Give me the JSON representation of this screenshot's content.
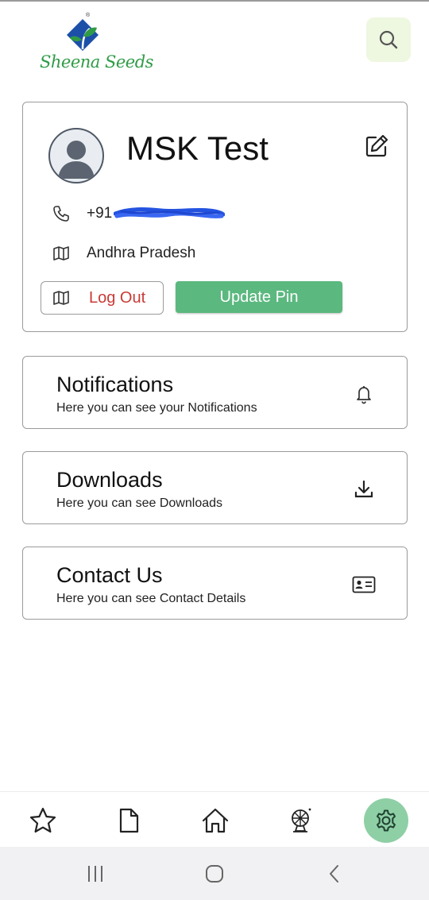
{
  "brand": {
    "logo_text": "Sheena Seeds",
    "registered_mark": "®",
    "colors": {
      "green": "#2f9b46",
      "blue": "#1c4fa8"
    }
  },
  "header": {
    "search_icon": "search-icon"
  },
  "profile": {
    "name": "MSK Test",
    "phone_prefix": "+91",
    "phone_redacted": true,
    "state": "Andhra Pradesh",
    "logout_label": "Log Out",
    "update_pin_label": "Update Pin",
    "colors": {
      "logout_text": "#c93a36",
      "update_bg": "#5bb87f"
    }
  },
  "menu": [
    {
      "title": "Notifications",
      "subtitle": "Here you can see your Notifications",
      "icon": "bell-icon"
    },
    {
      "title": "Downloads",
      "subtitle": "Here you can see Downloads",
      "icon": "download-icon"
    },
    {
      "title": "Contact Us",
      "subtitle": "Here you can see Contact Details",
      "icon": "contact-card-icon"
    }
  ],
  "bottom_nav": {
    "items": [
      {
        "icon": "star-icon",
        "active": false
      },
      {
        "icon": "document-icon",
        "active": false
      },
      {
        "icon": "home-icon",
        "active": false
      },
      {
        "icon": "wheel-icon",
        "active": false
      },
      {
        "icon": "gear-icon",
        "active": true
      }
    ],
    "active_color": "#8ecfa5"
  },
  "system_nav": {
    "icons": [
      "recent-apps-icon",
      "home-circle-icon",
      "back-icon"
    ]
  }
}
